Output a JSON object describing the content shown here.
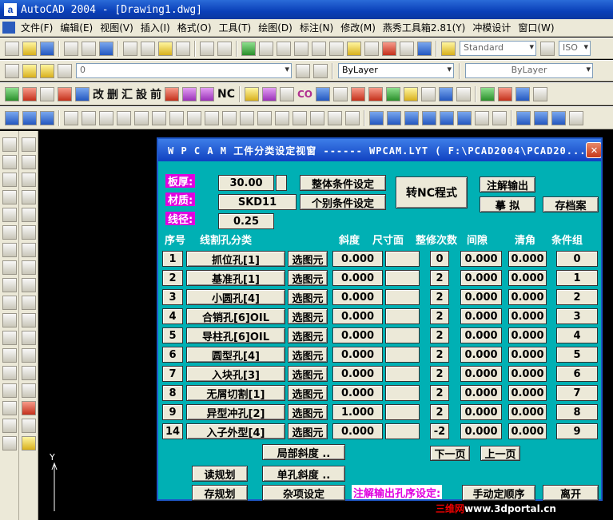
{
  "window": {
    "title": "AutoCAD 2004 - [Drawing1.dwg]",
    "app_icon": "a"
  },
  "menu": {
    "items": [
      "文件(F)",
      "编辑(E)",
      "视图(V)",
      "插入(I)",
      "格式(O)",
      "工具(T)",
      "绘图(D)",
      "标注(N)",
      "修改(M)",
      "燕秀工具箱2.81(Y)",
      "冲模设计",
      "窗口(W)"
    ]
  },
  "toolbar_std": {
    "textstyle_combo": "Standard",
    "dimstyle_combo": "ISO"
  },
  "toolbar_layers": {
    "layer_combo": "0",
    "color_combo": "ByLayer",
    "linetype_combo": "ByLayer"
  },
  "toolbar_custom": {
    "buttons": [
      "改",
      "删",
      "汇",
      "設",
      "前",
      "NC",
      "CO"
    ]
  },
  "ucs": {
    "y_label": "Y"
  },
  "dialog": {
    "title": "W P C A M  工件分类设定视窗 ------ WPCAM.LYT ( F:\\PCAD2004\\PCAD20...",
    "close": "✕",
    "thickness": {
      "label": "板厚:",
      "value": "30.00"
    },
    "material": {
      "label": "材质:",
      "value": "SKD11"
    },
    "wire": {
      "label": "线径:",
      "value": "0.25"
    },
    "btn_overall": "整体条件设定",
    "btn_individual": "个别条件设定",
    "btn_nc": "转NC程式",
    "btn_annotate": "注解输出",
    "btn_simulate": "摹 拟",
    "btn_archive": "存档案",
    "headers": {
      "seq": "序号",
      "category": "线割孔分类",
      "slope": "斜度",
      "size": "尺寸面",
      "trim": "整修次数",
      "gap": "间隙",
      "corner": "清角",
      "cond": "条件组"
    },
    "select_label": "选图元",
    "rows": [
      {
        "seq": "1",
        "name": "抓位孔[1]",
        "slope": "0.000",
        "trim": "0",
        "gap": "0.000",
        "corner": "0.000",
        "cond": "0"
      },
      {
        "seq": "2",
        "name": "基准孔[1]",
        "slope": "0.000",
        "trim": "2",
        "gap": "0.000",
        "corner": "0.000",
        "cond": "1"
      },
      {
        "seq": "3",
        "name": "小圆孔[4]",
        "slope": "0.000",
        "trim": "2",
        "gap": "0.000",
        "corner": "0.000",
        "cond": "2"
      },
      {
        "seq": "4",
        "name": "合销孔[6]OIL",
        "slope": "0.000",
        "trim": "2",
        "gap": "0.000",
        "corner": "0.000",
        "cond": "3"
      },
      {
        "seq": "5",
        "name": "导柱孔[6]OIL",
        "slope": "0.000",
        "trim": "2",
        "gap": "0.000",
        "corner": "0.000",
        "cond": "4"
      },
      {
        "seq": "6",
        "name": "圆型孔[4]",
        "slope": "0.000",
        "trim": "2",
        "gap": "0.000",
        "corner": "0.000",
        "cond": "5"
      },
      {
        "seq": "7",
        "name": "入块孔[3]",
        "slope": "0.000",
        "trim": "2",
        "gap": "0.000",
        "corner": "0.000",
        "cond": "6"
      },
      {
        "seq": "8",
        "name": "无屑切割[1]",
        "slope": "0.000",
        "trim": "2",
        "gap": "0.000",
        "corner": "0.000",
        "cond": "7"
      },
      {
        "seq": "9",
        "name": "异型冲孔[2]",
        "slope": "1.000",
        "trim": "2",
        "gap": "0.000",
        "corner": "0.000",
        "cond": "8"
      },
      {
        "seq": "14",
        "name": "入子外型[4]",
        "slope": "0.000",
        "trim": "-2",
        "gap": "0.000",
        "corner": "0.000",
        "cond": "9"
      }
    ],
    "btn_local_slope": "局部斜度 ..",
    "btn_next": "下一页",
    "btn_prev": "上一页",
    "btn_read": "读规划",
    "btn_single_slope": "单孔斜度 ..",
    "btn_save": "存规划",
    "btn_misc": "杂项设定",
    "order_label": "注解输出孔序设定:",
    "btn_manual_order": "手动定顺序",
    "btn_leave": "离开"
  },
  "watermark": {
    "part1": "三维网",
    "part2": "www.3dportal.cn"
  }
}
